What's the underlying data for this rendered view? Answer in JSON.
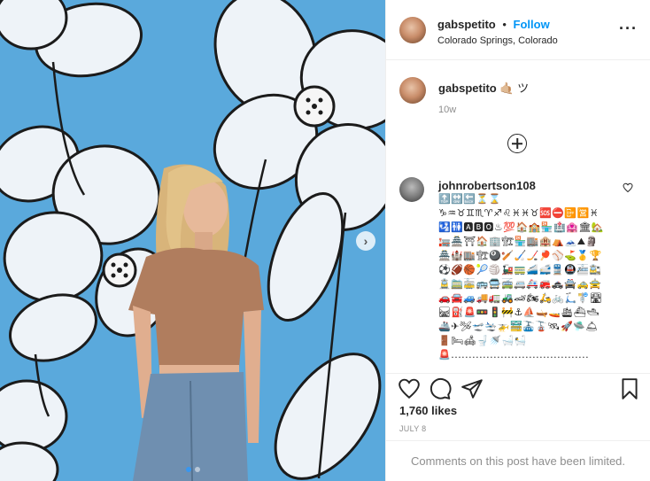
{
  "post": {
    "username": "gabspetito",
    "follow_label": "Follow",
    "separator": "•",
    "location": "Colorado Springs, Colorado",
    "more_label": "···",
    "next_label": "›"
  },
  "caption": {
    "username": "gabspetito",
    "text": "🤙🏼 ツ",
    "time": "10w"
  },
  "comment": {
    "username": "johnrobertson108",
    "text": "🔝🔛🔙⏳⌛♑♒♉♊♏♈♐♌♓♓♉🆘⛔📴🈺♓🛂🚻🅰🅱🅾♨💯🏠🏫🏪🏥🏩🏛🏡🏣🏯⛩🏠🏢🏗🏪🏬🏨⛺🗻⛰🗿🏯🏰🏬🏗🎱🏏🏑🏒🏓⚾⛳🥇🏆⚽🏈🏀🎾🏐🚂🚃🚄🚅🚆🚇🚈🚉🚊🚞🚋🚌🚍🚎🚐🚑🚒🚓🚔🚕🚖🚗🚘🚙🚚🚛🚜🏎🏍🛵🚲🛴🚏🛣🛤⛽🚨🚥🚦🚧⚓⛵🛶🚤🛳⛴🛥🚢✈🛩🛫🛬🚁🚟🚠🚡🛰🚀🛸🛎🚪🛏🛋🚽🚿🛁🛀🚨......................................."
  },
  "actions": {
    "like": "heart-icon",
    "comment": "comment-icon",
    "share": "share-icon",
    "save": "bookmark-icon"
  },
  "likes": "1,760 likes",
  "date": "JULY 8",
  "comments_limited": "Comments on this post have been limited.",
  "colors": {
    "wall": "#5aa9dc",
    "follow": "#0095f6",
    "shirt": "#b07d5e",
    "jeans": "#6f8fb0",
    "hair": "#d8b47a"
  }
}
